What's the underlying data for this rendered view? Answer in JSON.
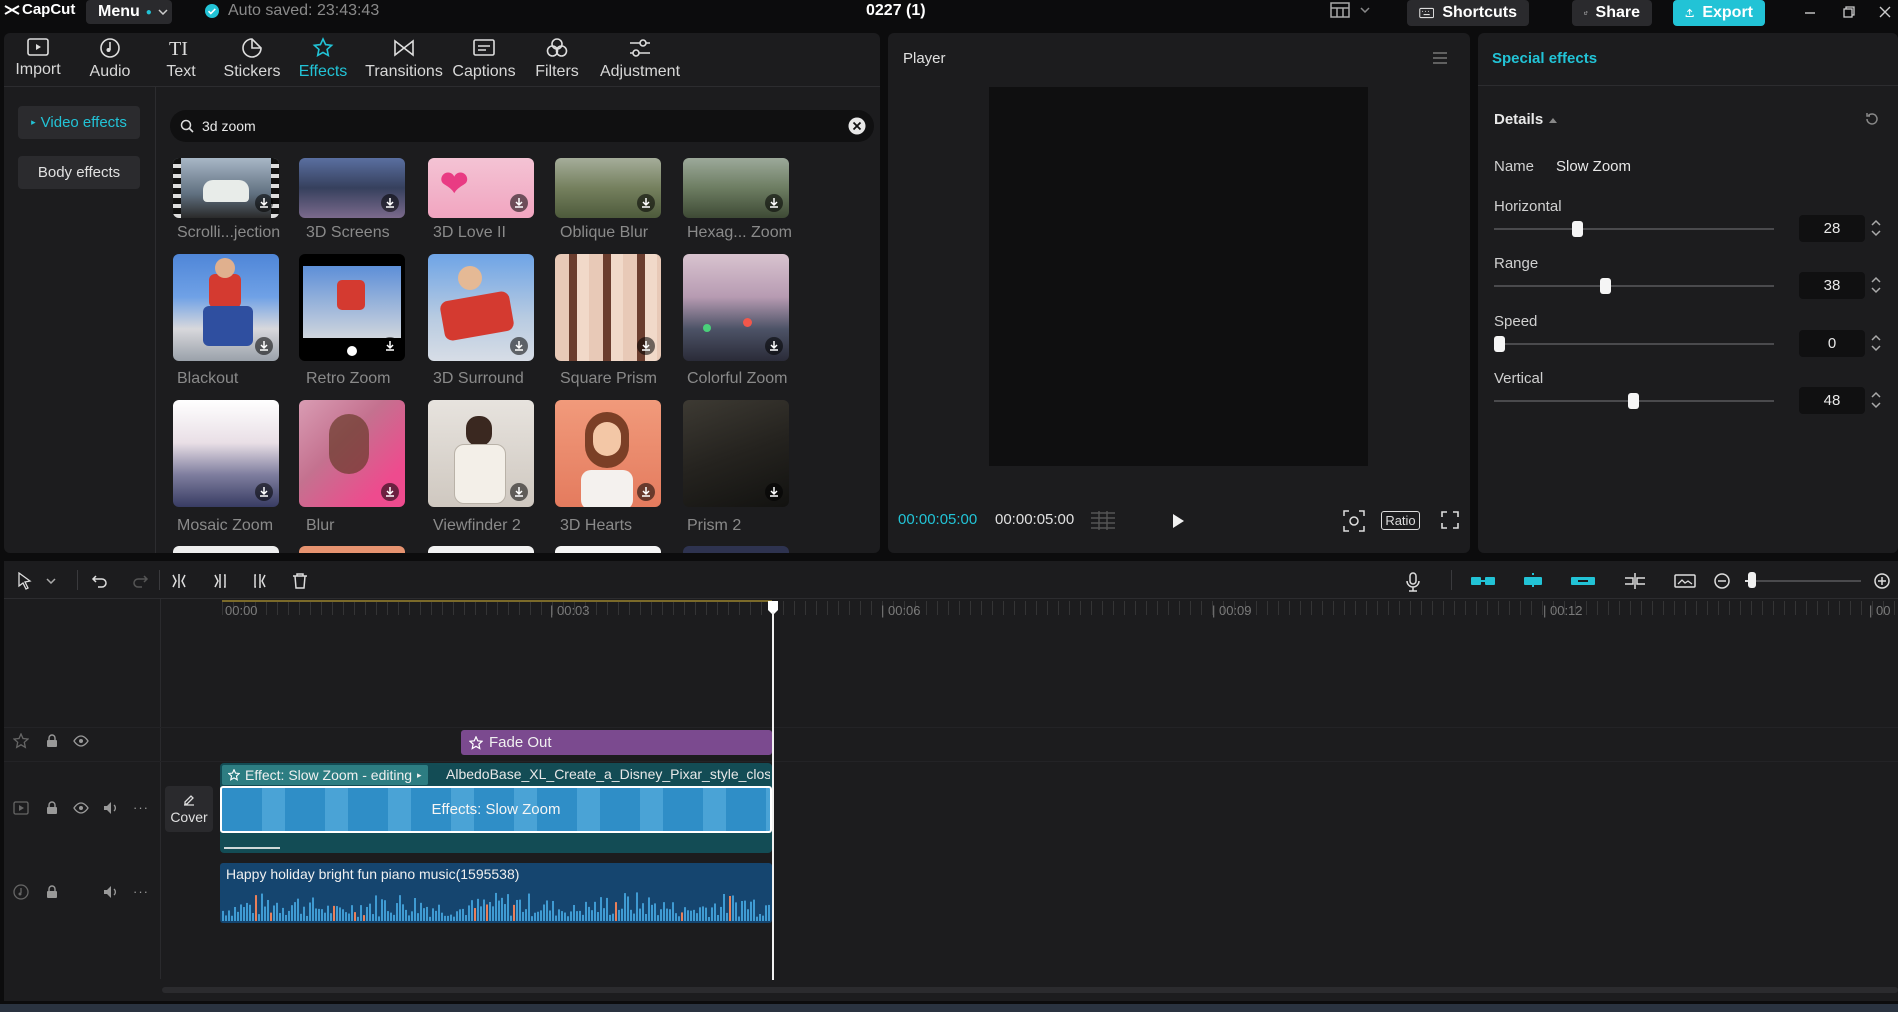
{
  "titlebar": {
    "app_name": "CapCut",
    "menu_label": "Menu",
    "autosave_text": "Auto saved: 23:43:43",
    "project_title": "0227 (1)",
    "shortcuts_label": "Shortcuts",
    "share_label": "Share",
    "export_label": "Export"
  },
  "toolbar": {
    "items": [
      {
        "label": "Import",
        "icon": "import-icon"
      },
      {
        "label": "Audio",
        "icon": "audio-icon"
      },
      {
        "label": "Text",
        "icon": "text-icon"
      },
      {
        "label": "Stickers",
        "icon": "stickers-icon"
      },
      {
        "label": "Effects",
        "icon": "effects-icon",
        "active": true
      },
      {
        "label": "Transitions",
        "icon": "transitions-icon"
      },
      {
        "label": "Captions",
        "icon": "captions-icon"
      },
      {
        "label": "Filters",
        "icon": "filters-icon"
      },
      {
        "label": "Adjustment",
        "icon": "adjustment-icon"
      }
    ]
  },
  "sidebar": {
    "items": [
      {
        "label": "Video effects",
        "active": true
      },
      {
        "label": "Body effects"
      }
    ]
  },
  "search": {
    "value": "3d zoom"
  },
  "effects": {
    "row1": [
      "Scrolli...jection",
      "3D Screens",
      "3D Love II",
      "Oblique Blur",
      "Hexag... Zoom"
    ],
    "row2": [
      "Blackout",
      "Retro Zoom",
      "3D Surround",
      "Square Prism",
      "Colorful Zoom"
    ],
    "row3": [
      "Mosaic Zoom",
      "Blur",
      "Viewfinder 2",
      "3D Hearts",
      "Prism 2"
    ]
  },
  "player": {
    "title": "Player",
    "current_time": "00:00:05:00",
    "total_time": "00:00:05:00",
    "ratio_label": "Ratio"
  },
  "props": {
    "panel_title": "Special effects",
    "section_title": "Details",
    "name_label": "Name",
    "name_value": "Slow Zoom",
    "params": [
      {
        "label": "Horizontal",
        "value": "28",
        "fraction": 0.28
      },
      {
        "label": "Range",
        "value": "38",
        "fraction": 0.38
      },
      {
        "label": "Speed",
        "value": "0",
        "fraction": 0.0
      },
      {
        "label": "Vertical",
        "value": "48",
        "fraction": 0.48
      }
    ]
  },
  "timeline": {
    "ruler": [
      "00:00",
      "| 00:03",
      "| 00:06",
      "| 00:09",
      "| 00:12",
      "| 00"
    ],
    "effect_clip": "Fade Out",
    "video_header": "Effect: Slow Zoom - editing",
    "video_name": "AlbedoBase_XL_Create_a_Disney_Pixar_style_close",
    "video_overlay": "Effects:  Slow Zoom",
    "cover_label": "Cover",
    "audio_clip": "Happy holiday bright fun piano music(1595538)"
  },
  "colors": {
    "accent": "#22c3d6",
    "effect_clip": "#7b4a8f",
    "video_clip": "#1f8bb8",
    "audio_clip": "#15456f"
  }
}
